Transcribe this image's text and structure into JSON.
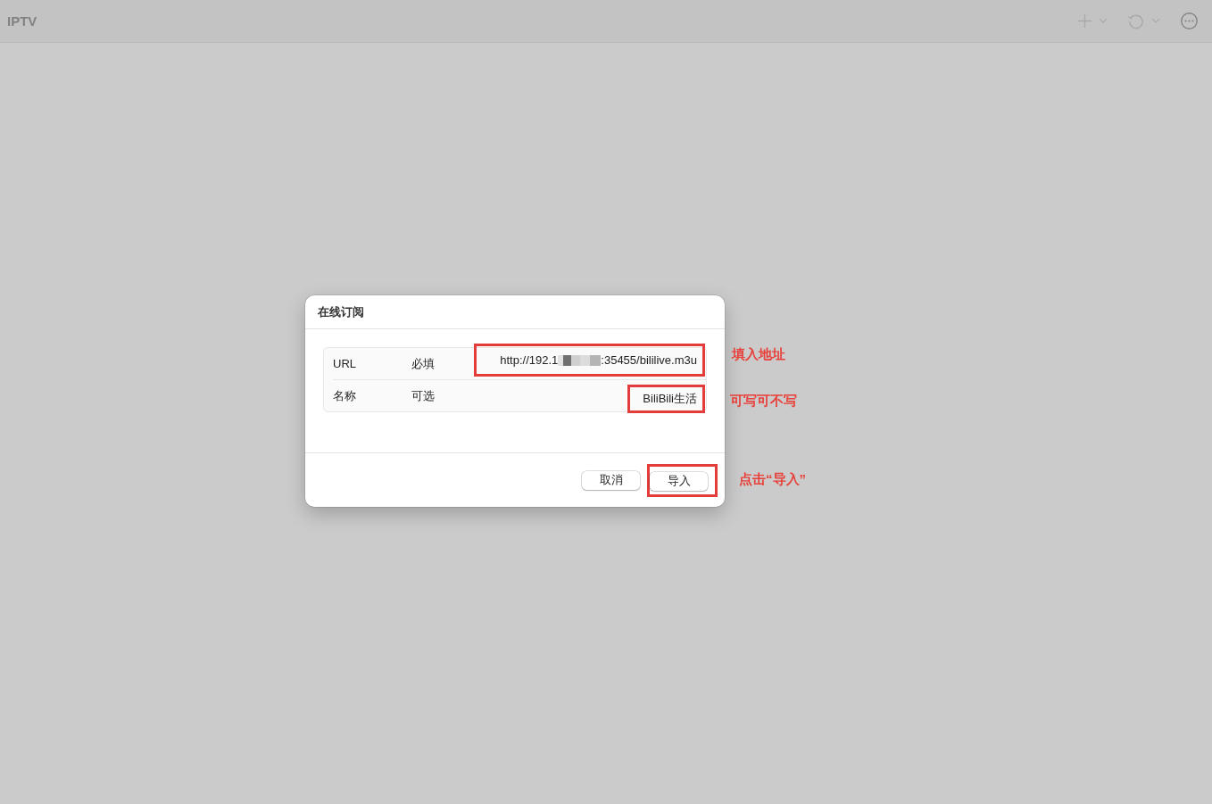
{
  "app": {
    "title": "IPTV"
  },
  "toolbar": [
    {
      "kind": "add",
      "menu": true,
      "disabled": true
    },
    {
      "kind": "refresh",
      "menu": true,
      "disabled": true
    },
    {
      "kind": "more",
      "menu": false,
      "disabled": false
    }
  ],
  "dialog": {
    "title": "在线订阅",
    "fields": [
      {
        "label": "URL",
        "note": "必填",
        "value": "http://192.1",
        "redacted": true,
        "value_tail": ":35455/bililive.m3u",
        "highlighted": true
      },
      {
        "label": "名称",
        "note": "可选",
        "value": "BiliBili生活",
        "highlighted": true
      }
    ],
    "buttons": [
      {
        "label": "取消",
        "highlighted": false
      },
      {
        "label": "导入",
        "highlighted": true
      }
    ]
  },
  "annotations": [
    {
      "text": "填入地址"
    },
    {
      "text": "可写可不写"
    },
    {
      "text": "点击“导入”"
    }
  ]
}
